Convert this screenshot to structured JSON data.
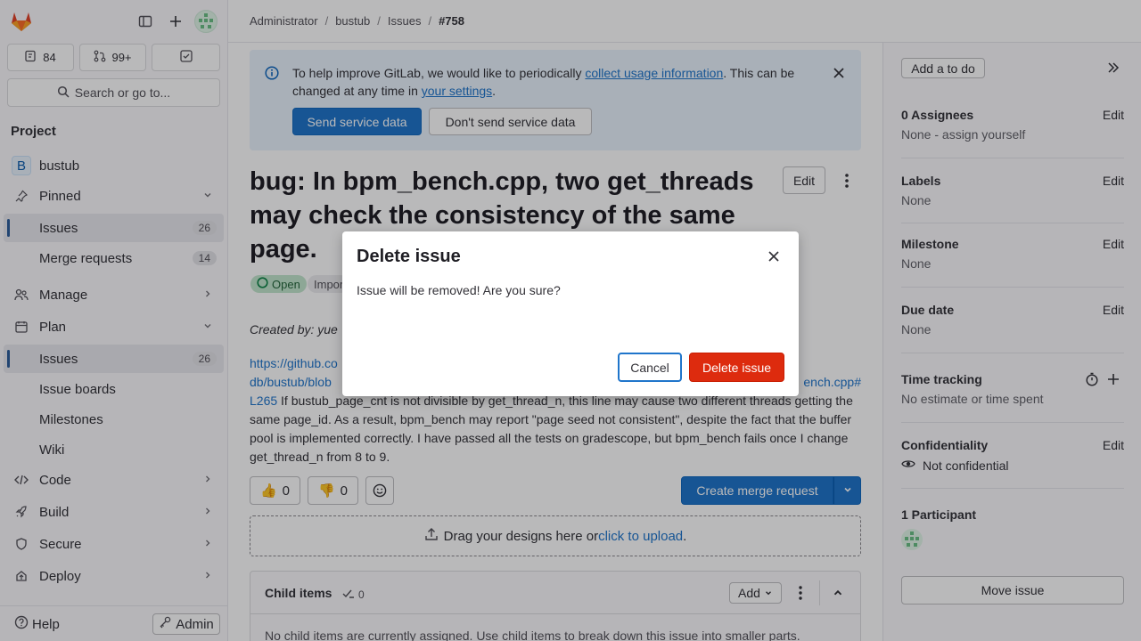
{
  "sidebar": {
    "issues_count": "84",
    "mr_count": "99+",
    "search_label": "Search or go to...",
    "section_title": "Project",
    "project_avatar": "B",
    "project_name": "bustub",
    "pinned_label": "Pinned",
    "pinned_items": [
      {
        "label": "Issues",
        "count": "26"
      },
      {
        "label": "Merge requests",
        "count": "14"
      }
    ],
    "manage_label": "Manage",
    "plan_label": "Plan",
    "plan_items": [
      {
        "label": "Issues",
        "count": "26"
      },
      {
        "label": "Issue boards"
      },
      {
        "label": "Milestones"
      },
      {
        "label": "Wiki"
      }
    ],
    "code_label": "Code",
    "build_label": "Build",
    "secure_label": "Secure",
    "deploy_label": "Deploy",
    "help_label": "Help",
    "admin_label": "Admin"
  },
  "breadcrumb": [
    "Administrator",
    "bustub",
    "Issues",
    "#758"
  ],
  "banner": {
    "text_1": "To help improve GitLab, we would like to periodically ",
    "link_1": "collect usage information",
    "text_2": ". This can be changed at any time in ",
    "link_2": "your settings",
    "text_3": ".",
    "send_label": "Send service data",
    "dont_send_label": "Don't send service data"
  },
  "issue": {
    "title": "bug: In bpm_bench.cpp, two get_threads may check the consistency of the same page.",
    "edit_label": "Edit",
    "status": "Open",
    "imported_label": "Impor",
    "created_by": "Created by: yue",
    "link_a": "https://github.co",
    "link_b": "db/bustub/blob",
    "link_c": "ench.cpp#",
    "link_d": "L265",
    "body": " If bustub_page_cnt is not divisible by get_thread_n, this line may cause two different threads getting the same page_id. As a result, bpm_bench may report \"page seed not consistent\", despite the fact that the buffer pool is implemented correctly. I have passed all the tests on gradescope, but bpm_bench fails once I change get_thread_n from 8 to 9.",
    "thumbs_up": "0",
    "thumbs_down": "0",
    "create_mr_label": "Create merge request",
    "upload_text": "Drag your designs here or ",
    "upload_link": "click to upload",
    "upload_end": ".",
    "child_title": "Child items",
    "child_count": "0",
    "child_add": "Add",
    "child_empty": "No child items are currently assigned. Use child items to break down this issue into smaller parts."
  },
  "right": {
    "todo_label": "Add a to do",
    "edit_label": "Edit",
    "assignees_title": "0 Assignees",
    "assignees_value": "None - assign yourself",
    "labels_title": "Labels",
    "labels_value": "None",
    "milestone_title": "Milestone",
    "milestone_value": "None",
    "due_title": "Due date",
    "due_value": "None",
    "time_title": "Time tracking",
    "time_value": "No estimate or time spent",
    "conf_title": "Confidentiality",
    "conf_value": "Not confidential",
    "participants_title": "1 Participant",
    "move_label": "Move issue"
  },
  "modal": {
    "title": "Delete issue",
    "body": "Issue will be removed! Are you sure?",
    "cancel_label": "Cancel",
    "delete_label": "Delete issue"
  },
  "colors": {
    "brand_orange": "#e24329",
    "primary_blue": "#1f75cb",
    "danger_red": "#dd2b0e",
    "open_green": "#108548"
  },
  "icons": [
    "gitlab-logo-icon",
    "sidebar-toggle-icon",
    "plus-icon",
    "avatar-icon",
    "issues-icon",
    "merge-request-icon",
    "todo-icon",
    "search-icon",
    "pin-icon",
    "chevron-down-icon",
    "users-icon",
    "calendar-icon",
    "code-icon",
    "rocket-icon",
    "shield-icon",
    "deploy-icon",
    "help-icon",
    "key-icon",
    "info-icon",
    "close-icon",
    "kebab-icon",
    "emoji-icon",
    "upload-icon",
    "check-icon",
    "double-chevron-icon",
    "timer-icon",
    "eye-icon"
  ]
}
